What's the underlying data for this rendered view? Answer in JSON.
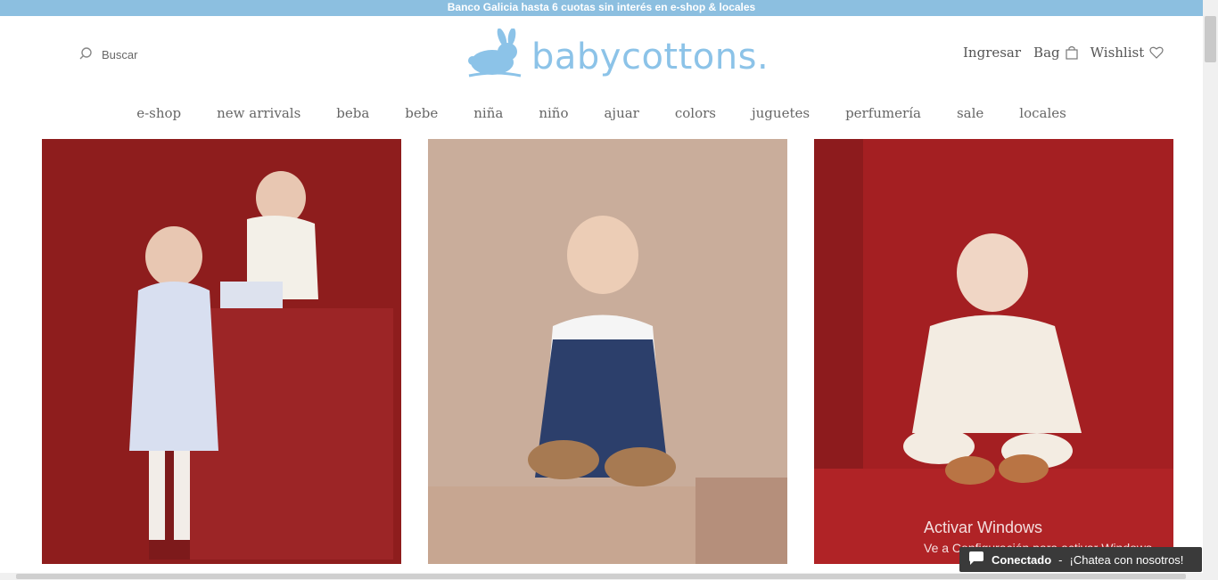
{
  "promo": {
    "text": "Banco Galicia hasta 6 cuotas sin interés en e-shop & locales"
  },
  "search": {
    "label": "Buscar",
    "icon": "search-icon"
  },
  "logo": {
    "text": "babycottons.",
    "icon": "rabbit-logo-icon",
    "color": "#8cc3e8"
  },
  "account": {
    "login": "Ingresar",
    "bag": "Bag",
    "wishlist": "Wishlist",
    "bag_icon": "shopping-bag-icon",
    "wishlist_icon": "heart-icon"
  },
  "nav": {
    "items": [
      "e-shop",
      "new arrivals",
      "beba",
      "bebe",
      "niña",
      "niño",
      "ajuar",
      "colors",
      "juguetes",
      "perfumería",
      "sale",
      "locales"
    ]
  },
  "watermark": {
    "title": "Activar Windows",
    "subtitle": "Ve a Configuración para activar Windows."
  },
  "chat": {
    "status": "Conectado",
    "message": "¡Chatea con nosotros!",
    "icon": "chat-bubble-icon"
  },
  "colors": {
    "promo_bg": "#8cbfe0",
    "photo1_bg": "#8e1d1d",
    "photo2_bg": "#c9ad9b",
    "photo3_bg": "#a41f22",
    "chat_bg": "#3a3a3a"
  }
}
